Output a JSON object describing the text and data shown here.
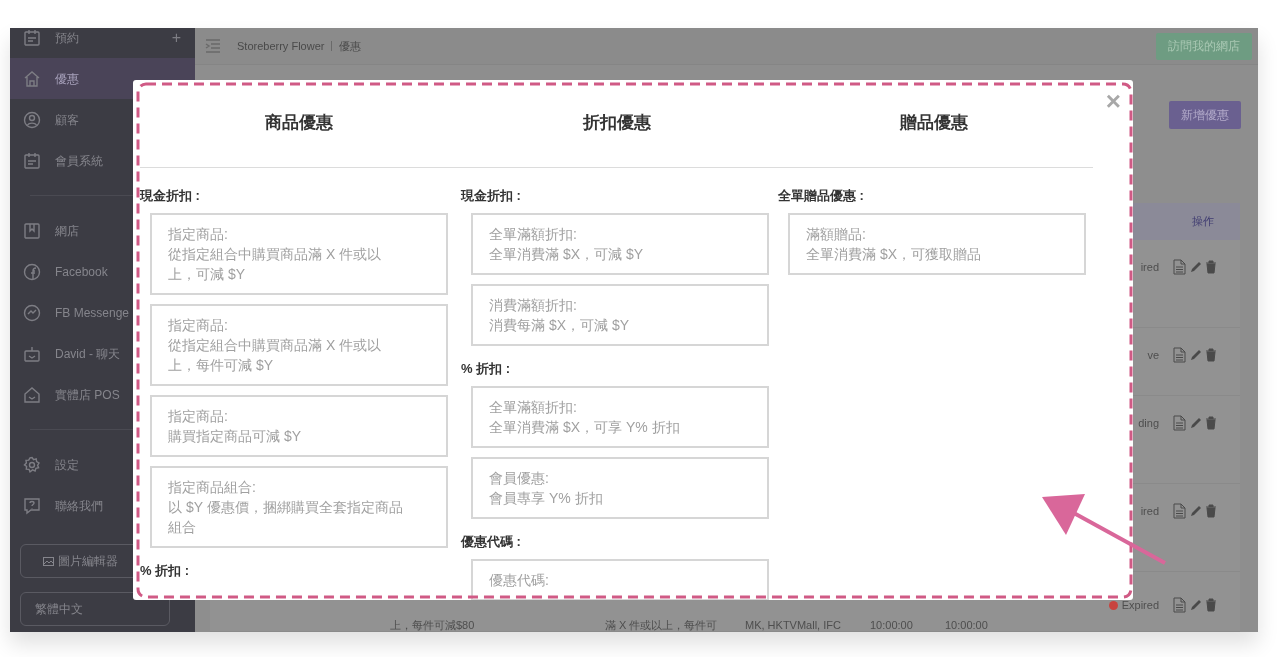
{
  "sidebar": {
    "groups": [
      [
        {
          "label": "預約",
          "action": "+",
          "selected": false
        },
        {
          "label": "優惠",
          "selected": true
        },
        {
          "label": "顧客",
          "selected": false
        },
        {
          "label": "會員系統",
          "selected": false
        }
      ],
      [
        {
          "label": "網店",
          "selected": false
        },
        {
          "label": "Facebook",
          "selected": false
        },
        {
          "label": "FB Messenge",
          "selected": false
        },
        {
          "label": "David - 聊天",
          "selected": false
        },
        {
          "label": "實體店 POS",
          "selected": false
        }
      ],
      [
        {
          "label": "設定",
          "selected": false
        },
        {
          "label": "聯絡我們",
          "selected": false
        }
      ]
    ],
    "buttons": [
      "圖片編輯器",
      "繁體中文"
    ]
  },
  "header": {
    "breadcrumb": [
      "Storeberry Flower",
      "優惠"
    ],
    "visit_button": "訪問我的網店"
  },
  "page": {
    "add_button": "新增優惠",
    "table": {
      "action_column": "操作",
      "rows": [
        {
          "status": "ired"
        },
        {
          "status": "ve"
        },
        {
          "status": "ding"
        },
        {
          "status": "ired"
        },
        {
          "status": "Expired",
          "color": "#c8433f",
          "second_line": [
            "上，每件可減$80",
            "滿 X 件或以上，每件可",
            "MK, HKTVMall, IFC",
            "10:00:00",
            "10:00:00"
          ]
        }
      ]
    }
  },
  "modal": {
    "close": "×",
    "columns": [
      {
        "title": "商品優惠",
        "sections": [
          {
            "label": "現金折扣 :",
            "options": [
              {
                "title": "指定商品:",
                "description": "從指定組合中購買商品滿 X 件或以上，可減 $Y"
              },
              {
                "title": "指定商品:",
                "description": "從指定組合中購買商品滿 X 件或以上，每件可減 $Y"
              },
              {
                "title": "指定商品:",
                "description": "購買指定商品可減 $Y"
              },
              {
                "title": "指定商品組合:",
                "description": "以 $Y 優惠價，捆綁購買全套指定商品組合"
              }
            ]
          },
          {
            "label": "% 折扣 :"
          }
        ]
      },
      {
        "title": "折扣優惠",
        "sections": [
          {
            "label": "現金折扣 :",
            "options": [
              {
                "title": "全單滿額折扣:",
                "description": "全單消費滿 $X，可減 $Y"
              },
              {
                "title": "消費滿額折扣:",
                "description": "消費每滿 $X，可減 $Y"
              }
            ]
          },
          {
            "label": "% 折扣 :",
            "options": [
              {
                "title": "全單滿額折扣:",
                "description": "全單消費滿 $X，可享 Y% 折扣"
              },
              {
                "title": "會員優惠:",
                "description": "會員專享 Y% 折扣"
              }
            ]
          },
          {
            "label": "優惠代碼 :",
            "options": [
              {
                "title": "優惠代碼:"
              }
            ]
          }
        ]
      },
      {
        "title": "贈品優惠",
        "sections": [
          {
            "label": "全單贈品優惠 :",
            "options": [
              {
                "title": "滿額贈品:",
                "description": "全單消費滿 $X，可獲取贈品"
              }
            ]
          }
        ]
      }
    ]
  }
}
